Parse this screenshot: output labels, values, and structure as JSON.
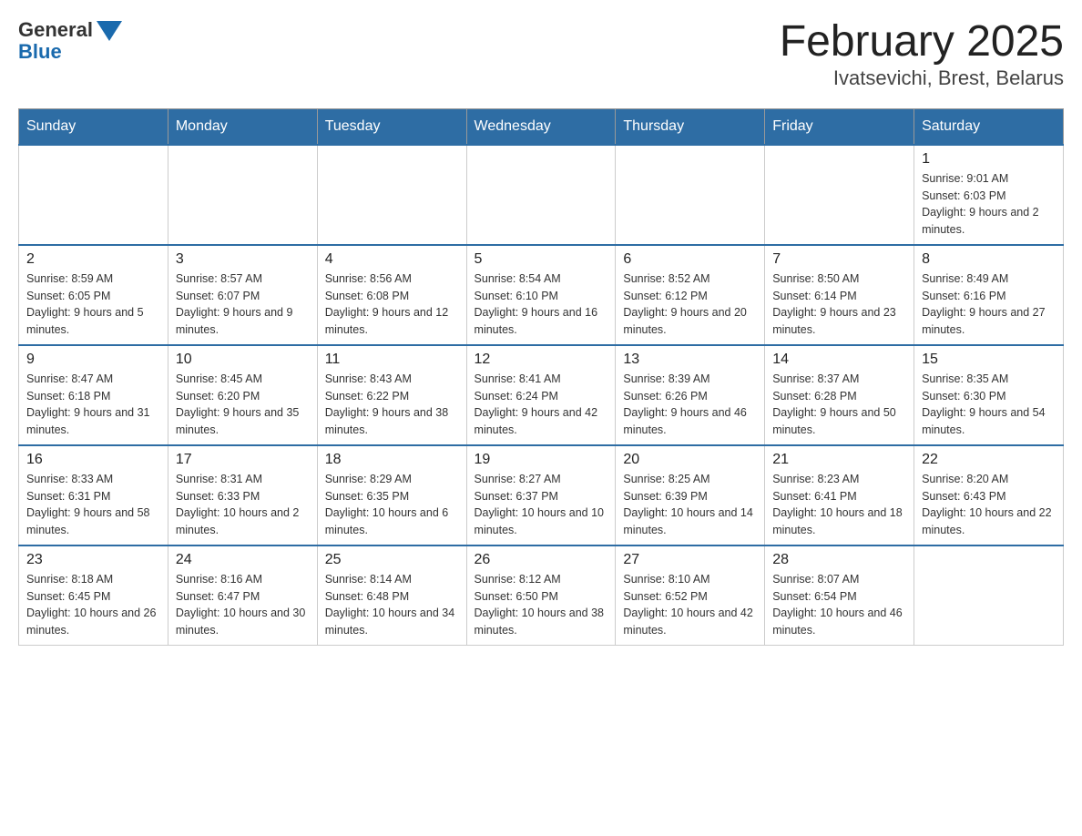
{
  "header": {
    "logo_general": "General",
    "logo_blue": "Blue",
    "title": "February 2025",
    "subtitle": "Ivatsevichi, Brest, Belarus"
  },
  "calendar": {
    "days_of_week": [
      "Sunday",
      "Monday",
      "Tuesday",
      "Wednesday",
      "Thursday",
      "Friday",
      "Saturday"
    ],
    "weeks": [
      [
        {
          "day": "",
          "info": ""
        },
        {
          "day": "",
          "info": ""
        },
        {
          "day": "",
          "info": ""
        },
        {
          "day": "",
          "info": ""
        },
        {
          "day": "",
          "info": ""
        },
        {
          "day": "",
          "info": ""
        },
        {
          "day": "1",
          "info": "Sunrise: 9:01 AM\nSunset: 6:03 PM\nDaylight: 9 hours and 2 minutes."
        }
      ],
      [
        {
          "day": "2",
          "info": "Sunrise: 8:59 AM\nSunset: 6:05 PM\nDaylight: 9 hours and 5 minutes."
        },
        {
          "day": "3",
          "info": "Sunrise: 8:57 AM\nSunset: 6:07 PM\nDaylight: 9 hours and 9 minutes."
        },
        {
          "day": "4",
          "info": "Sunrise: 8:56 AM\nSunset: 6:08 PM\nDaylight: 9 hours and 12 minutes."
        },
        {
          "day": "5",
          "info": "Sunrise: 8:54 AM\nSunset: 6:10 PM\nDaylight: 9 hours and 16 minutes."
        },
        {
          "day": "6",
          "info": "Sunrise: 8:52 AM\nSunset: 6:12 PM\nDaylight: 9 hours and 20 minutes."
        },
        {
          "day": "7",
          "info": "Sunrise: 8:50 AM\nSunset: 6:14 PM\nDaylight: 9 hours and 23 minutes."
        },
        {
          "day": "8",
          "info": "Sunrise: 8:49 AM\nSunset: 6:16 PM\nDaylight: 9 hours and 27 minutes."
        }
      ],
      [
        {
          "day": "9",
          "info": "Sunrise: 8:47 AM\nSunset: 6:18 PM\nDaylight: 9 hours and 31 minutes."
        },
        {
          "day": "10",
          "info": "Sunrise: 8:45 AM\nSunset: 6:20 PM\nDaylight: 9 hours and 35 minutes."
        },
        {
          "day": "11",
          "info": "Sunrise: 8:43 AM\nSunset: 6:22 PM\nDaylight: 9 hours and 38 minutes."
        },
        {
          "day": "12",
          "info": "Sunrise: 8:41 AM\nSunset: 6:24 PM\nDaylight: 9 hours and 42 minutes."
        },
        {
          "day": "13",
          "info": "Sunrise: 8:39 AM\nSunset: 6:26 PM\nDaylight: 9 hours and 46 minutes."
        },
        {
          "day": "14",
          "info": "Sunrise: 8:37 AM\nSunset: 6:28 PM\nDaylight: 9 hours and 50 minutes."
        },
        {
          "day": "15",
          "info": "Sunrise: 8:35 AM\nSunset: 6:30 PM\nDaylight: 9 hours and 54 minutes."
        }
      ],
      [
        {
          "day": "16",
          "info": "Sunrise: 8:33 AM\nSunset: 6:31 PM\nDaylight: 9 hours and 58 minutes."
        },
        {
          "day": "17",
          "info": "Sunrise: 8:31 AM\nSunset: 6:33 PM\nDaylight: 10 hours and 2 minutes."
        },
        {
          "day": "18",
          "info": "Sunrise: 8:29 AM\nSunset: 6:35 PM\nDaylight: 10 hours and 6 minutes."
        },
        {
          "day": "19",
          "info": "Sunrise: 8:27 AM\nSunset: 6:37 PM\nDaylight: 10 hours and 10 minutes."
        },
        {
          "day": "20",
          "info": "Sunrise: 8:25 AM\nSunset: 6:39 PM\nDaylight: 10 hours and 14 minutes."
        },
        {
          "day": "21",
          "info": "Sunrise: 8:23 AM\nSunset: 6:41 PM\nDaylight: 10 hours and 18 minutes."
        },
        {
          "day": "22",
          "info": "Sunrise: 8:20 AM\nSunset: 6:43 PM\nDaylight: 10 hours and 22 minutes."
        }
      ],
      [
        {
          "day": "23",
          "info": "Sunrise: 8:18 AM\nSunset: 6:45 PM\nDaylight: 10 hours and 26 minutes."
        },
        {
          "day": "24",
          "info": "Sunrise: 8:16 AM\nSunset: 6:47 PM\nDaylight: 10 hours and 30 minutes."
        },
        {
          "day": "25",
          "info": "Sunrise: 8:14 AM\nSunset: 6:48 PM\nDaylight: 10 hours and 34 minutes."
        },
        {
          "day": "26",
          "info": "Sunrise: 8:12 AM\nSunset: 6:50 PM\nDaylight: 10 hours and 38 minutes."
        },
        {
          "day": "27",
          "info": "Sunrise: 8:10 AM\nSunset: 6:52 PM\nDaylight: 10 hours and 42 minutes."
        },
        {
          "day": "28",
          "info": "Sunrise: 8:07 AM\nSunset: 6:54 PM\nDaylight: 10 hours and 46 minutes."
        },
        {
          "day": "",
          "info": ""
        }
      ]
    ]
  }
}
